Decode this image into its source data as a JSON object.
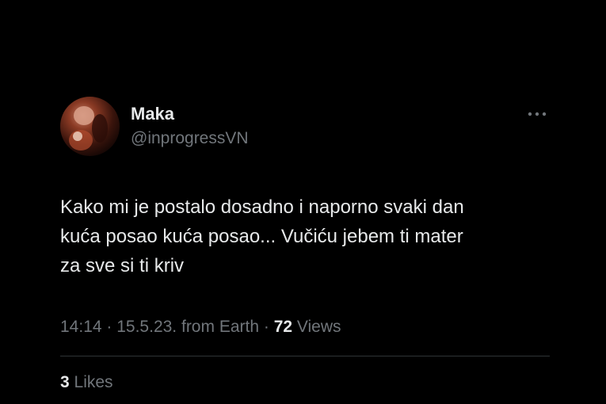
{
  "tweet": {
    "author": {
      "name": "Maka",
      "handle": "@inprogressVN"
    },
    "text_lines": [
      "Kako mi je postalo dosadno i naporno svaki dan",
      "kuća posao kuća posao... Vučiću jebem ti mater",
      "za sve si ti kriv"
    ],
    "meta": {
      "time": "14:14",
      "separator": " · ",
      "date": "15.5.23.",
      "source": "from Earth",
      "views_count": "72",
      "views_label": " Views"
    },
    "likes": {
      "count": "3",
      "label": " Likes"
    }
  },
  "icons": {
    "more": "more-horizontal-icon"
  },
  "colors": {
    "background": "#000000",
    "primary_text": "#e7e9ea",
    "secondary_text": "#71767b",
    "divider": "#2f3336"
  }
}
